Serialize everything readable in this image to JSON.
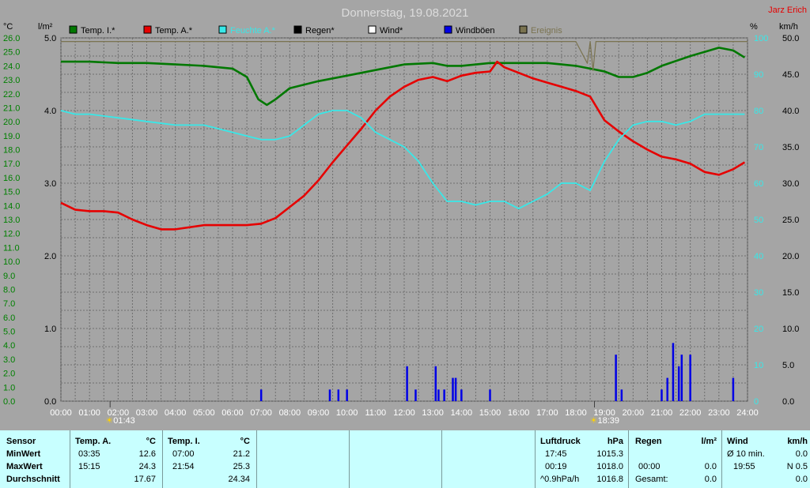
{
  "title": "Donnerstag, 19.08.2021",
  "owner": "Jarz Erich",
  "units": {
    "temp": "°C",
    "rain": "l/m²",
    "humidity": "%",
    "wind": "km/h"
  },
  "colors": {
    "background": "#a5a5a5",
    "plot": "#a5a5a5",
    "grid": "#6e6e6e",
    "temp_inside": "#007800",
    "temp_outside": "#e60000",
    "humidity": "#38e8e8",
    "wind_gusts": "#0000e6",
    "pressure": "#7a7350",
    "table_bg": "#c8ffff",
    "owner": "#e60000"
  },
  "legend": [
    {
      "label": "Temp. I.*",
      "color": "#007800"
    },
    {
      "label": "Temp. A.*",
      "color": "#e60000"
    },
    {
      "label": "Feuchte A.*",
      "color": "#38e8e8"
    },
    {
      "label": "Regen*",
      "color": "#000000"
    },
    {
      "label": "Wind*",
      "color": "#ffffff"
    },
    {
      "label": "Windböen",
      "color": "#0000e6"
    },
    {
      "label": "Ereignis",
      "color": "#7a7350"
    }
  ],
  "markers": [
    {
      "time": 1.72,
      "label": "01:43"
    },
    {
      "time": 18.65,
      "label": "18:39"
    }
  ],
  "chart_data": {
    "type": "line",
    "x_axis": {
      "range": [
        0,
        24
      ],
      "ticks": [
        "00:00",
        "01:00",
        "02:00",
        "03:00",
        "04:00",
        "05:00",
        "06:00",
        "07:00",
        "08:00",
        "09:00",
        "10:00",
        "11:00",
        "12:00",
        "13:00",
        "14:00",
        "15:00",
        "16:00",
        "17:00",
        "18:00",
        "19:00",
        "20:00",
        "21:00",
        "22:00",
        "23:00",
        "24:00"
      ]
    },
    "y_left_temp": {
      "range": [
        0,
        26
      ],
      "ticks": [
        "26.0",
        "25.0",
        "24.0",
        "23.0",
        "22.0",
        "21.0",
        "20.0",
        "19.0",
        "18.0",
        "17.0",
        "16.0",
        "15.0",
        "14.0",
        "13.0",
        "12.0",
        "11.0",
        "10.0",
        "9.0",
        "8.0",
        "7.0",
        "6.0",
        "5.0",
        "4.0",
        "3.0",
        "2.0",
        "1.0",
        "0.0"
      ]
    },
    "y_left_rain": {
      "range": [
        0,
        5
      ],
      "ticks": [
        "5.0",
        "4.0",
        "3.0",
        "2.0",
        "1.0",
        "0.0"
      ]
    },
    "y_right_humidity": {
      "range": [
        0,
        100
      ],
      "ticks": [
        "100",
        "90",
        "80",
        "70",
        "60",
        "50",
        "40",
        "30",
        "20",
        "10",
        "0"
      ]
    },
    "y_right_wind": {
      "range": [
        0,
        50
      ],
      "ticks": [
        "50.0",
        "45.0",
        "40.0",
        "35.0",
        "30.0",
        "25.0",
        "20.0",
        "15.0",
        "10.0",
        "5.0",
        "0.0"
      ]
    },
    "grid": true,
    "series": [
      {
        "name": "Temp. I.*",
        "axis": "temp",
        "x": [
          0,
          1,
          2,
          3,
          4,
          5,
          6,
          6.5,
          6.9,
          7.2,
          7.5,
          8,
          9,
          10,
          11,
          12,
          13,
          13.5,
          14,
          15,
          16,
          17,
          17.5,
          18,
          18.5,
          19,
          19.5,
          20,
          20.5,
          21,
          22,
          23,
          23.5,
          23.9
        ],
        "y": [
          24.3,
          24.3,
          24.2,
          24.2,
          24.1,
          24.0,
          23.8,
          23.2,
          21.6,
          21.2,
          21.6,
          22.4,
          22.9,
          23.3,
          23.7,
          24.1,
          24.2,
          24.0,
          24.0,
          24.2,
          24.2,
          24.2,
          24.1,
          24.0,
          23.8,
          23.6,
          23.2,
          23.2,
          23.5,
          24.0,
          24.7,
          25.3,
          25.1,
          24.6
        ]
      },
      {
        "name": "Temp. A.*",
        "axis": "temp",
        "x": [
          0,
          0.5,
          1,
          1.5,
          2,
          2.5,
          3,
          3.5,
          4,
          5,
          6,
          6.5,
          7,
          7.5,
          8,
          8.5,
          9,
          9.5,
          10,
          10.5,
          11,
          11.5,
          12,
          12.5,
          13,
          13.5,
          14,
          14.5,
          15,
          15.25,
          15.5,
          16,
          16.5,
          17,
          17.5,
          18,
          18.5,
          19,
          19.5,
          20,
          20.5,
          21,
          21.5,
          22,
          22.5,
          23,
          23.5,
          23.9
        ],
        "y": [
          14.2,
          13.7,
          13.6,
          13.6,
          13.5,
          13.0,
          12.6,
          12.3,
          12.3,
          12.6,
          12.6,
          12.6,
          12.7,
          13.1,
          13.9,
          14.7,
          15.8,
          17.1,
          18.3,
          19.5,
          20.8,
          21.8,
          22.5,
          23.0,
          23.2,
          22.9,
          23.3,
          23.5,
          23.6,
          24.3,
          23.9,
          23.5,
          23.1,
          22.8,
          22.5,
          22.2,
          21.8,
          20.1,
          19.3,
          18.6,
          18.0,
          17.5,
          17.3,
          17.0,
          16.4,
          16.2,
          16.6,
          17.1
        ]
      },
      {
        "name": "Feuchte A.*",
        "axis": "humidity",
        "x": [
          0,
          0.5,
          1,
          2,
          3,
          4,
          5,
          6,
          6.5,
          7,
          7.5,
          8,
          8.5,
          9,
          9.5,
          10,
          10.5,
          11,
          11.5,
          12,
          12.5,
          13,
          13.5,
          14,
          14.5,
          15,
          15.5,
          16,
          16.5,
          17,
          17.5,
          18,
          18.5,
          19,
          19.5,
          20,
          20.5,
          21,
          21.5,
          22,
          22.5,
          23,
          23.5,
          23.9
        ],
        "y": [
          80,
          79,
          79,
          78,
          77,
          76,
          76,
          74,
          73,
          72,
          72,
          73,
          76,
          79,
          80,
          80,
          78,
          74,
          72,
          70,
          66,
          60,
          55,
          55,
          54,
          55,
          55,
          53,
          55,
          57,
          60,
          60,
          58,
          66,
          72,
          76,
          77,
          77,
          76,
          77,
          79,
          79,
          79,
          79
        ]
      },
      {
        "name": "Windböen",
        "axis": "wind",
        "x": [
          6.8,
          7.0,
          9.0,
          9.4,
          9.7,
          10.0,
          12.0,
          12.1,
          12.3,
          12.4,
          13.0,
          13.1,
          13.2,
          13.4,
          13.5,
          13.7,
          13.8,
          14.0,
          14.2,
          15.0,
          15.1,
          19.4,
          19.6,
          19.8,
          21.0,
          21.2,
          21.3,
          21.4,
          21.6,
          21.7,
          21.8,
          22.0,
          23.4,
          23.5
        ],
        "y": [
          0,
          1.6,
          0,
          1.6,
          1.6,
          1.6,
          0,
          4.8,
          0,
          1.6,
          0,
          4.8,
          1.6,
          1.6,
          0,
          3.2,
          3.2,
          1.6,
          0,
          1.6,
          0,
          6.4,
          1.6,
          0,
          1.6,
          3.2,
          0,
          8.0,
          4.8,
          6.4,
          0,
          6.4,
          0,
          3.2
        ]
      },
      {
        "name": "Ereignis",
        "axis": "humidity",
        "x": [
          0,
          2,
          4,
          6,
          8,
          10,
          12,
          14,
          16,
          17,
          18,
          18.4,
          18.5,
          18.6,
          18.7,
          19,
          20,
          22,
          24
        ],
        "y": [
          99,
          99,
          99,
          99,
          99,
          99,
          99,
          99,
          99,
          99,
          99,
          93,
          99,
          91,
          99,
          99,
          99,
          99,
          99
        ]
      }
    ]
  },
  "table": {
    "sensor_col": {
      "header": "Sensor",
      "rows": [
        "MinWert",
        "MaxWert",
        "Durchschnitt"
      ]
    },
    "temp_a": {
      "header": "Temp. A.",
      "unit": "°C",
      "min_time": "03:35",
      "min_val": "12.6",
      "max_time": "15:15",
      "max_val": "24.3",
      "avg": "17.67"
    },
    "temp_i": {
      "header": "Temp. I.",
      "unit": "°C",
      "min_time": "07:00",
      "min_val": "21.2",
      "max_time": "21:54",
      "max_val": "25.3",
      "avg": "24.34"
    },
    "pressure": {
      "header": "Luftdruck",
      "unit": "hPa",
      "min_time": "17:45",
      "min_val": "1015.3",
      "max_time": "00:19",
      "max_val": "1018.0",
      "trend": "^0.9hPa/h",
      "avg": "1016.8"
    },
    "rain": {
      "header": "Regen",
      "unit": "l/m²",
      "max_time": "00:00",
      "max_val": "0.0",
      "total_label": "Gesamt:",
      "total": "0.0"
    },
    "wind": {
      "header": "Wind",
      "unit": "km/h",
      "avg10_label": "Ø 10 min.",
      "avg10": "0.0",
      "max_time": "19:55",
      "max_val": "N 0.5",
      "avg": "0.0"
    }
  }
}
